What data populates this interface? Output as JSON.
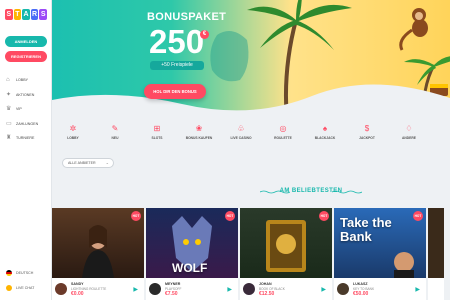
{
  "sidebar": {
    "logo_letters": [
      "S",
      "T",
      "A",
      "R",
      "S"
    ],
    "login_label": "ANMELDEN",
    "register_label": "REGISTRIEREN",
    "items": [
      {
        "label": "LOBBY",
        "icon": "home-icon"
      },
      {
        "label": "AKTIONEN",
        "icon": "gift-icon"
      },
      {
        "label": "VIP",
        "icon": "crown-icon"
      },
      {
        "label": "ZAHLUNGEN",
        "icon": "wallet-icon"
      },
      {
        "label": "TURNIERE",
        "icon": "trophy-icon"
      }
    ],
    "language": "DEUTSCH",
    "live_chat": "LIVE CHAT"
  },
  "hero": {
    "title": "BONUSPAKET",
    "amount": "250",
    "currency": "€",
    "freespins": "+50 Freispiele",
    "cta_label": "HOL DIR DEN BONUS"
  },
  "categories": [
    {
      "label": "LOBBY",
      "icon": "lobby-icon"
    },
    {
      "label": "NEU",
      "icon": "new-icon"
    },
    {
      "label": "SLOTS",
      "icon": "slots-icon"
    },
    {
      "label": "BONUS KAUFEN",
      "icon": "bonus-buy-icon"
    },
    {
      "label": "LIVE CASINO",
      "icon": "live-casino-icon"
    },
    {
      "label": "ROULETTE",
      "icon": "roulette-icon"
    },
    {
      "label": "BLACKJACK",
      "icon": "blackjack-icon"
    },
    {
      "label": "JACKPOT",
      "icon": "jackpot-icon"
    },
    {
      "label": "ANDERE",
      "icon": "other-icon"
    }
  ],
  "filter": {
    "label": "ALLE ANBIETER"
  },
  "section_title": "AM BELIEBTESTEN",
  "games": [
    {
      "name": "SANDY",
      "provider": "LIGHTNING ROULETTE",
      "amount": "€0.00",
      "hot": "HOT"
    },
    {
      "name": "MEYNER",
      "provider": "PLAYSOFF",
      "amount": "€7.50",
      "hot": "HOT",
      "art_title": "WOLF"
    },
    {
      "name": "JOHAN",
      "provider": "BOOK OF BLACK",
      "amount": "€12.50",
      "hot": "HOT"
    },
    {
      "name": "LUKASZ",
      "provider": "KEY TO BANK",
      "amount": "€50.00",
      "hot": "HOT",
      "art_title": "Take the Bank"
    }
  ],
  "colors": {
    "teal": "#17b8ac",
    "coral": "#ff4a62"
  }
}
